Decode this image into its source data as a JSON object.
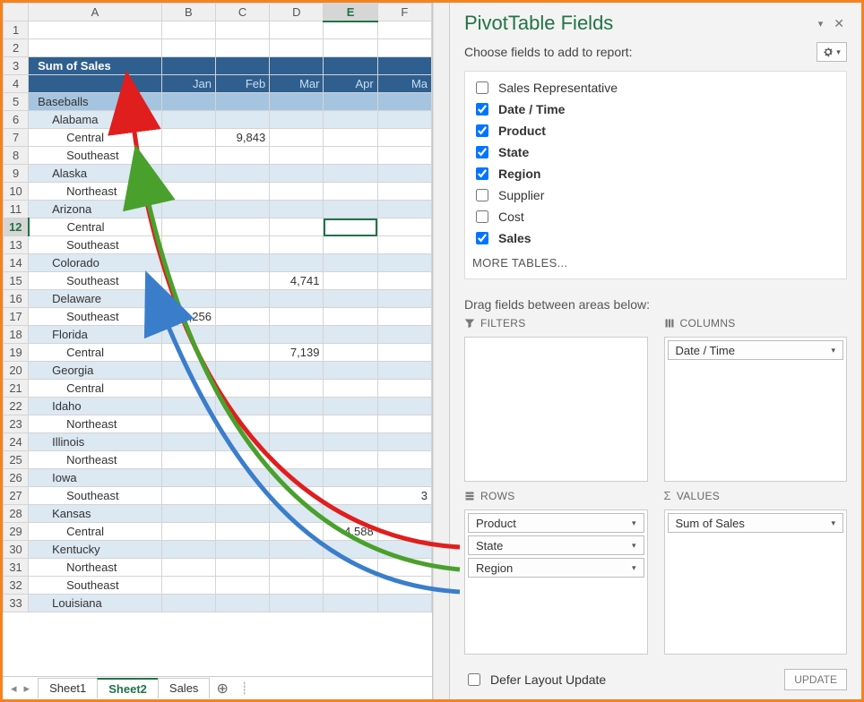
{
  "pivot": {
    "sum_label": "Sum of Sales",
    "columns": [
      "Jan",
      "Feb",
      "Mar",
      "Apr",
      "Ma"
    ],
    "rows": [
      {
        "r": 5,
        "lvl": 1,
        "label": "Baseballs",
        "vals": [
          "",
          "",
          "",
          "",
          ""
        ]
      },
      {
        "r": 6,
        "lvl": 2,
        "label": "Alabama",
        "vals": [
          "",
          "",
          "",
          "",
          ""
        ]
      },
      {
        "r": 7,
        "lvl": 3,
        "label": "Central",
        "vals": [
          "",
          "9,843",
          "",
          "",
          ""
        ]
      },
      {
        "r": 8,
        "lvl": 3,
        "label": "Southeast",
        "vals": [
          "",
          "",
          "",
          "",
          ""
        ]
      },
      {
        "r": 9,
        "lvl": 2,
        "label": "Alaska",
        "vals": [
          "",
          "",
          "",
          "",
          ""
        ]
      },
      {
        "r": 10,
        "lvl": 3,
        "label": "Northeast",
        "vals": [
          "",
          "",
          "",
          "",
          ""
        ]
      },
      {
        "r": 11,
        "lvl": 2,
        "label": "Arizona",
        "vals": [
          "",
          "",
          "",
          "",
          ""
        ]
      },
      {
        "r": 12,
        "lvl": 3,
        "label": "Central",
        "vals": [
          "",
          "",
          "",
          "",
          ""
        ],
        "active": true
      },
      {
        "r": 13,
        "lvl": 3,
        "label": "Southeast",
        "vals": [
          "",
          "",
          "",
          "",
          ""
        ]
      },
      {
        "r": 14,
        "lvl": 2,
        "label": "Colorado",
        "vals": [
          "",
          "",
          "",
          "",
          ""
        ]
      },
      {
        "r": 15,
        "lvl": 3,
        "label": "Southeast",
        "vals": [
          "",
          "",
          "4,741",
          "",
          ""
        ]
      },
      {
        "r": 16,
        "lvl": 2,
        "label": "Delaware",
        "vals": [
          "",
          "",
          "",
          "",
          ""
        ]
      },
      {
        "r": 17,
        "lvl": 3,
        "label": "Southeast",
        "vals": [
          "4,256",
          "",
          "",
          "",
          ""
        ]
      },
      {
        "r": 18,
        "lvl": 2,
        "label": "Florida",
        "vals": [
          "",
          "",
          "",
          "",
          ""
        ]
      },
      {
        "r": 19,
        "lvl": 3,
        "label": "Central",
        "vals": [
          "",
          "",
          "7,139",
          "",
          ""
        ]
      },
      {
        "r": 20,
        "lvl": 2,
        "label": "Georgia",
        "vals": [
          "",
          "",
          "",
          "",
          ""
        ]
      },
      {
        "r": 21,
        "lvl": 3,
        "label": "Central",
        "vals": [
          "",
          "",
          "",
          "",
          ""
        ]
      },
      {
        "r": 22,
        "lvl": 2,
        "label": "Idaho",
        "vals": [
          "",
          "",
          "",
          "",
          ""
        ]
      },
      {
        "r": 23,
        "lvl": 3,
        "label": "Northeast",
        "vals": [
          "",
          "",
          "",
          "",
          ""
        ]
      },
      {
        "r": 24,
        "lvl": 2,
        "label": "Illinois",
        "vals": [
          "",
          "",
          "",
          "",
          ""
        ]
      },
      {
        "r": 25,
        "lvl": 3,
        "label": "Northeast",
        "vals": [
          "",
          "",
          "",
          "",
          ""
        ]
      },
      {
        "r": 26,
        "lvl": 2,
        "label": "Iowa",
        "vals": [
          "",
          "",
          "",
          "",
          ""
        ]
      },
      {
        "r": 27,
        "lvl": 3,
        "label": "Southeast",
        "vals": [
          "",
          "",
          "",
          "",
          "3"
        ]
      },
      {
        "r": 28,
        "lvl": 2,
        "label": "Kansas",
        "vals": [
          "",
          "",
          "",
          "",
          ""
        ]
      },
      {
        "r": 29,
        "lvl": 3,
        "label": "Central",
        "vals": [
          "",
          "",
          "",
          "4,588",
          ""
        ]
      },
      {
        "r": 30,
        "lvl": 2,
        "label": "Kentucky",
        "vals": [
          "",
          "",
          "",
          "",
          ""
        ]
      },
      {
        "r": 31,
        "lvl": 3,
        "label": "Northeast",
        "vals": [
          "",
          "",
          "",
          "",
          ""
        ]
      },
      {
        "r": 32,
        "lvl": 3,
        "label": "Southeast",
        "vals": [
          "",
          "",
          "",
          "",
          ""
        ]
      },
      {
        "r": 33,
        "lvl": 2,
        "label": "Louisiana",
        "vals": [
          "",
          "",
          "",
          "",
          ""
        ]
      }
    ]
  },
  "col_headers": [
    "A",
    "B",
    "C",
    "D",
    "E",
    "F"
  ],
  "selected_col_idx": 4,
  "selected_row": 12,
  "sheet_tabs": [
    "Sheet1",
    "Sheet2",
    "Sales"
  ],
  "active_tab_idx": 1,
  "pane": {
    "title": "PivotTable Fields",
    "subtitle": "Choose fields to add to report:",
    "fields": [
      {
        "label": "Sales Representative",
        "checked": false,
        "bold": false
      },
      {
        "label": "Date / Time",
        "checked": true,
        "bold": true
      },
      {
        "label": "Product",
        "checked": true,
        "bold": true
      },
      {
        "label": "State",
        "checked": true,
        "bold": true
      },
      {
        "label": "Region",
        "checked": true,
        "bold": true
      },
      {
        "label": "Supplier",
        "checked": false,
        "bold": false
      },
      {
        "label": "Cost",
        "checked": false,
        "bold": false
      },
      {
        "label": "Sales",
        "checked": true,
        "bold": true
      }
    ],
    "more_tables": "MORE TABLES...",
    "drag_label": "Drag fields between areas below:",
    "areas": {
      "filters_label": "FILTERS",
      "columns_label": "COLUMNS",
      "rows_label": "ROWS",
      "values_label": "VALUES",
      "filters": [],
      "columns": [
        "Date / Time"
      ],
      "rows": [
        "Product",
        "State",
        "Region"
      ],
      "values": [
        "Sum of Sales"
      ]
    },
    "defer_label": "Defer Layout Update",
    "update_label": "UPDATE"
  },
  "arrow_colors": {
    "red": "#e01e1e",
    "green": "#4aa02c",
    "blue": "#3a7ecb"
  }
}
